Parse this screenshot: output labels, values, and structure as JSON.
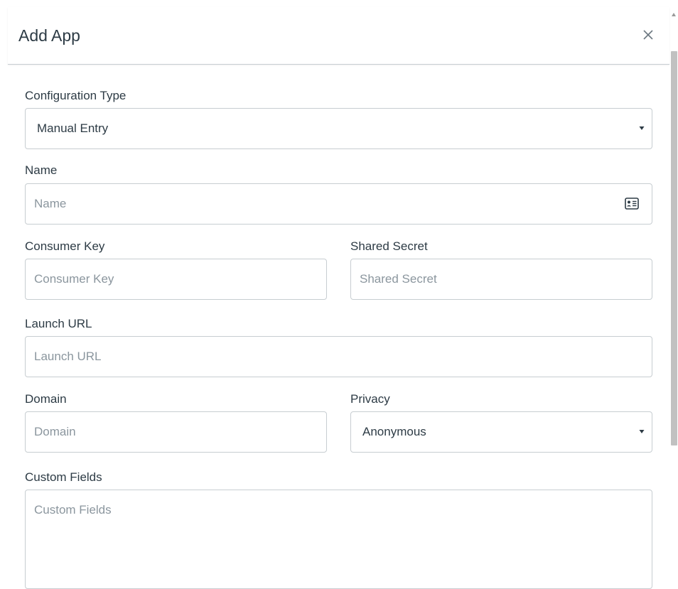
{
  "dialog": {
    "title": "Add App",
    "close_icon": "close-icon"
  },
  "form": {
    "configuration_type": {
      "label": "Configuration Type",
      "value": "Manual Entry",
      "icon": "chevron-down-icon"
    },
    "name": {
      "label": "Name",
      "placeholder": "Name",
      "value": "",
      "icon": "contact-card-icon"
    },
    "consumer_key": {
      "label": "Consumer Key",
      "placeholder": "Consumer Key",
      "value": ""
    },
    "shared_secret": {
      "label": "Shared Secret",
      "placeholder": "Shared Secret",
      "value": ""
    },
    "launch_url": {
      "label": "Launch URL",
      "placeholder": "Launch URL",
      "value": ""
    },
    "domain": {
      "label": "Domain",
      "placeholder": "Domain",
      "value": ""
    },
    "privacy": {
      "label": "Privacy",
      "value": "Anonymous",
      "icon": "chevron-down-icon"
    },
    "custom_fields": {
      "label": "Custom Fields",
      "placeholder": "Custom Fields",
      "value": ""
    }
  },
  "colors": {
    "text": "#2d3b45",
    "placeholder": "#8b969e",
    "border": "#c7cdd1",
    "scroll_thumb": "#c1c1c1"
  }
}
